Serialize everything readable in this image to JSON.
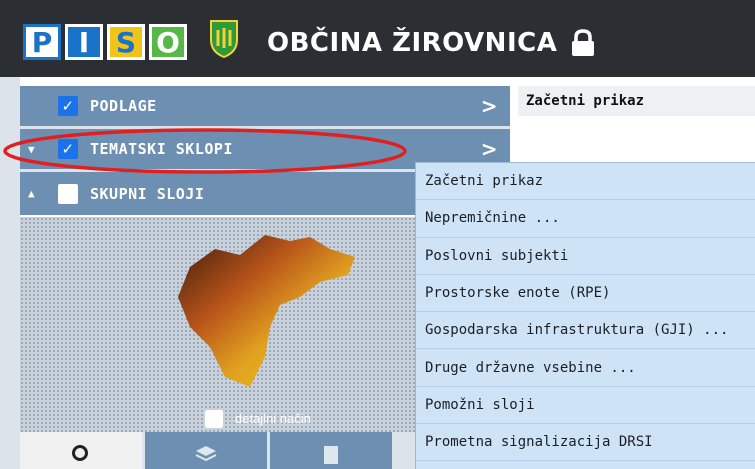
{
  "header": {
    "logo_letters": [
      "P",
      "I",
      "S",
      "O"
    ],
    "logo_colors": [
      {
        "bg": "#ffffff",
        "fg": "#1a73c8"
      },
      {
        "bg": "#1a73c8",
        "fg": "#ffffff"
      },
      {
        "bg": "#f0c419",
        "fg": "#1a73c8"
      },
      {
        "bg": "#58b847",
        "fg": "#ffffff"
      }
    ],
    "title": "OBČINA ŽIROVNICA",
    "crest_icon": "municipality-crest-icon",
    "lock_icon": "lock-icon"
  },
  "left_panel": {
    "rows": [
      {
        "label": "PODLAGE",
        "checked": true,
        "expand": "",
        "chevron": ">"
      },
      {
        "label": "TEMATSKI SKLOPI",
        "checked": true,
        "expand": "▼",
        "chevron": ">"
      },
      {
        "label": "SKUPNI SLOJI",
        "checked": false,
        "expand": "▲",
        "chevron": ""
      }
    ],
    "detail_mode_label": "detajlni način",
    "bottom_tab_icons": [
      "search-icon",
      "layers-icon",
      "document-icon"
    ]
  },
  "right_panel": {
    "header": "Začetni prikaz"
  },
  "dropdown": {
    "items": [
      "Začetni prikaz",
      "Nepremičnine ...",
      "Poslovni subjekti",
      "Prostorske enote (RPE)",
      "Gospodarska infrastruktura (GJI) ...",
      "Druge državne vsebine ...",
      "Pomožni sloji",
      "Prometna signalizacija DRSI"
    ]
  },
  "colors": {
    "header_bg": "#2b2f33",
    "panel_row": "#6d8fb1",
    "dropdown_bg": "#cfe3f7",
    "annotation": "#e02020"
  }
}
